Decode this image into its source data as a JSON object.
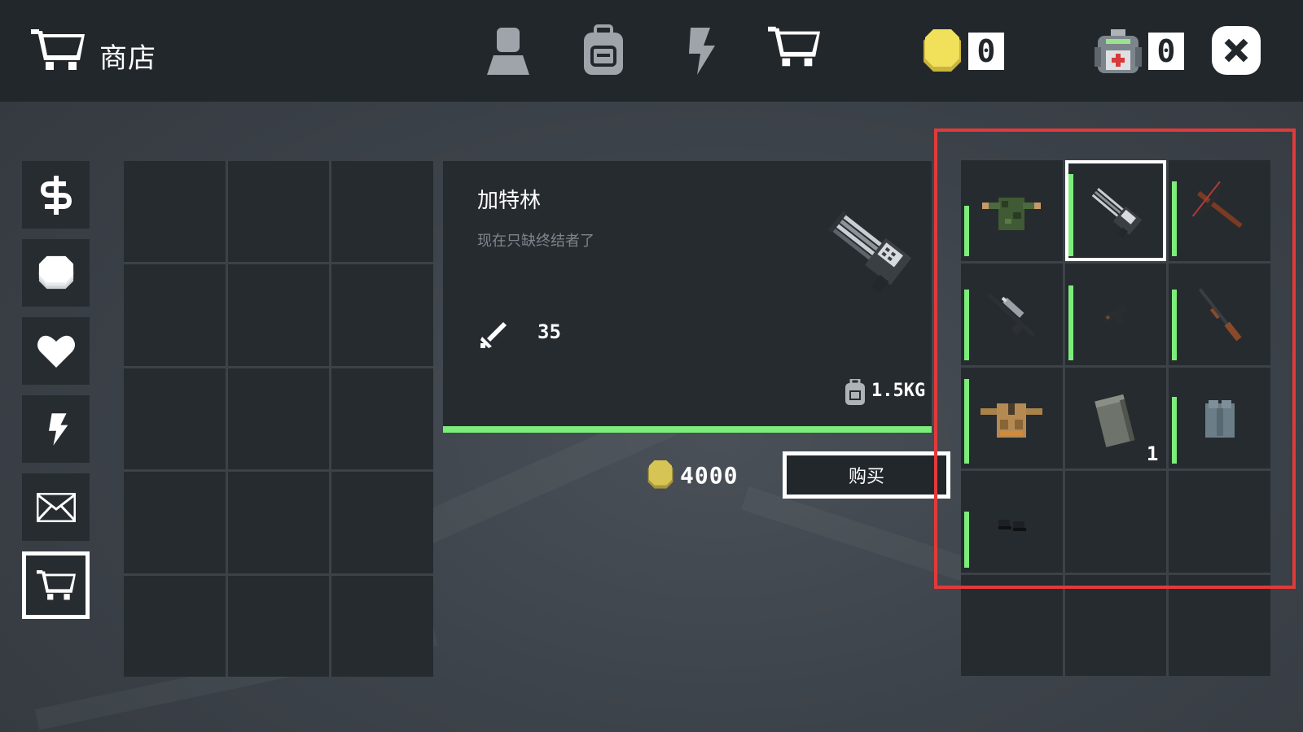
{
  "header": {
    "title": "商店",
    "tabs": [
      {
        "icon": "profile-icon"
      },
      {
        "icon": "backpack-icon"
      },
      {
        "icon": "energy-icon"
      },
      {
        "icon": "shop-cart-icon"
      }
    ],
    "coin_count": "0",
    "medkit_count": "0"
  },
  "sidebar": {
    "items": [
      {
        "icon": "dollar-icon"
      },
      {
        "icon": "coin-stack-icon"
      },
      {
        "icon": "heart-icon"
      },
      {
        "icon": "energy-icon"
      },
      {
        "icon": "mail-icon"
      },
      {
        "icon": "shop-cart-icon",
        "active": true
      }
    ]
  },
  "detail": {
    "name": "加特林",
    "description": "现在只缺终结者了",
    "damage": "35",
    "weight": "1.5KG",
    "price": "4000",
    "buy_label": "购买"
  },
  "shop": {
    "items": [
      {
        "icon": "camo-jacket-icon",
        "qty": ""
      },
      {
        "icon": "gatling-gun-icon",
        "qty": "",
        "selected": true
      },
      {
        "icon": "crossbow-icon",
        "qty": ""
      },
      {
        "icon": "sniper-rifle-icon",
        "qty": ""
      },
      {
        "icon": "pistol-icon",
        "qty": ""
      },
      {
        "icon": "shotgun-icon",
        "qty": ""
      },
      {
        "icon": "tactical-vest-icon",
        "qty": ""
      },
      {
        "icon": "ammo-box-icon",
        "qty": "1"
      },
      {
        "icon": "backpack-icon",
        "qty": ""
      },
      {
        "icon": "boots-icon",
        "qty": ""
      }
    ]
  },
  "colors": {
    "accent_green": "#7ded7a",
    "highlight_red": "#e23a3a",
    "panel": "#262b30",
    "topbar": "#22272c",
    "coin_gold": "#e8d44d"
  }
}
